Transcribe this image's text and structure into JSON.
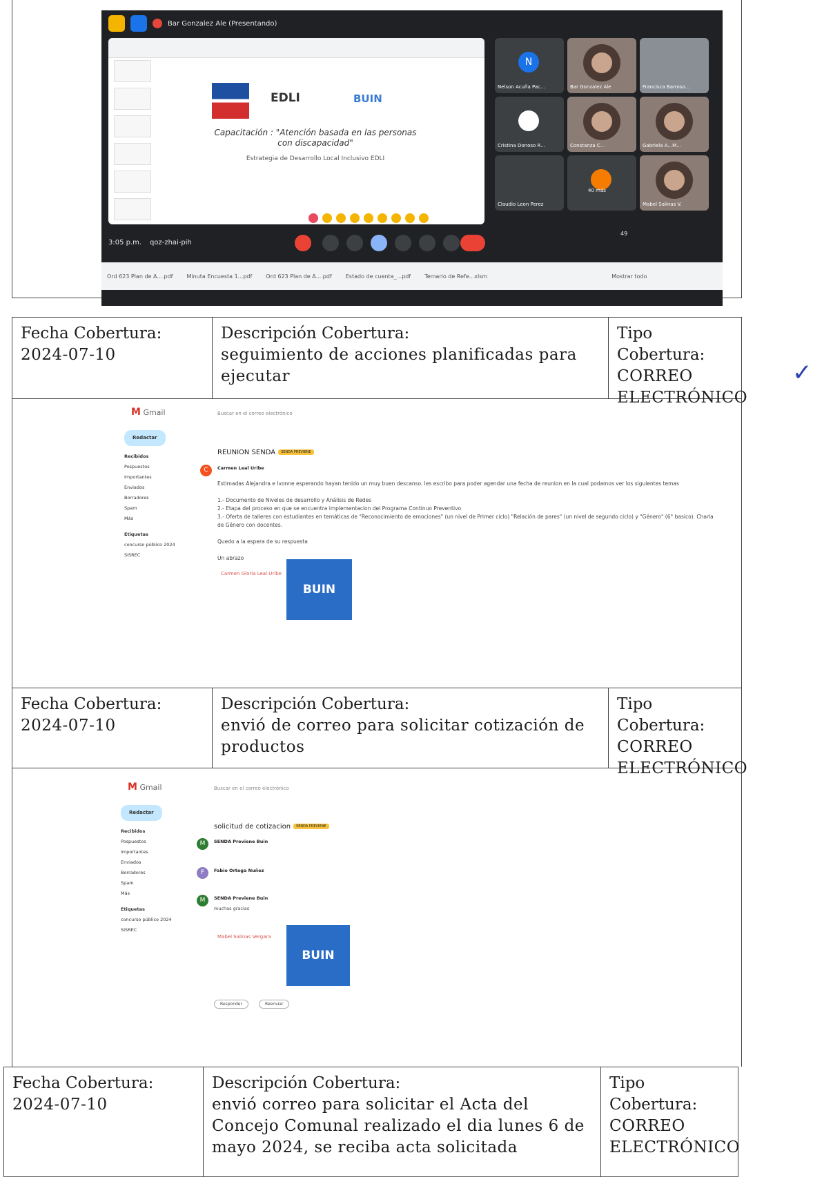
{
  "meet": {
    "presenter": "Bar Gonzalez Ale (Presentando)",
    "slide_logo_edli": "EDLI",
    "slide_logo_buin": "BUIN",
    "slide_title": "Capacitación : \"Atención basada en las personas con discapacidad\"",
    "slide_subtitle": "Estrategia de Desarrollo Local Inclusivo EDLI",
    "participants": [
      {
        "name": "Nelson Acuña Pac...",
        "initial": "N"
      },
      {
        "name": "Bar Gonzalez Ale",
        "initial": ""
      },
      {
        "name": "Francisca Barroso...",
        "initial": ""
      },
      {
        "name": "Cristina Donoso R...",
        "initial": ""
      },
      {
        "name": "Constanza C...",
        "initial": ""
      },
      {
        "name": "Gabriela A...M...",
        "initial": ""
      },
      {
        "name": "Claudio Leon Perez",
        "initial": ""
      },
      {
        "name": "40 más",
        "initial": ""
      },
      {
        "name": "Mabel Salinas V.",
        "initial": ""
      }
    ],
    "time": "3:05 p.m.",
    "meeting_code": "qoz-zhai-pih",
    "participant_count": "49",
    "downloads": [
      "Ord 623 Plan de A....pdf",
      "Minuta Encuesta 1...pdf",
      "Ord 623 Plan de A....pdf",
      "Estado de cuenta_...pdf",
      "Temario de Refe...xlsm"
    ],
    "show_all": "Mostrar todo"
  },
  "rows": [
    {
      "fecha_label": "Fecha Cobertura:",
      "fecha": "2024-07-10",
      "desc_label": "Descripción Cobertura:",
      "desc": "seguimiento de acciones planificadas para ejecutar",
      "tipo_label": "Tipo Cobertura:",
      "tipo": "CORREO ELECTRÓNICO"
    },
    {
      "fecha_label": "Fecha Cobertura:",
      "fecha": "2024-07-10",
      "desc_label": "Descripción Cobertura:",
      "desc": "envió de correo para solicitar cotización de productos",
      "tipo_label": "Tipo Cobertura:",
      "tipo": "CORREO ELECTRÓNICO"
    },
    {
      "fecha_label": "Fecha Cobertura:",
      "fecha": "2024-07-10",
      "desc_label": "Descripción Cobertura:",
      "desc": "envió correo para solicitar el Acta del Concejo Comunal realizado el dia lunes 6 de mayo 2024, se reciba acta solicitada",
      "tipo_label": "Tipo Cobertura:",
      "tipo": "CORREO ELECTRÓNICO"
    }
  ],
  "checkmark": "✓",
  "gmail1": {
    "app": "Gmail",
    "search_placeholder": "Buscar en el correo electrónico",
    "compose": "Redactar",
    "folders": [
      "Recibidos",
      "Pospuestos",
      "Importantes",
      "Enviados",
      "Borradores",
      "Spam",
      "Más"
    ],
    "labels_title": "Etiquetas",
    "labels": [
      "concurso público 2024",
      "SISREC"
    ],
    "subject": "REUNION SENDA",
    "tag": "SENDA PREVIENE",
    "sender": "Carmen Leal Uribe",
    "sender_initial": "C",
    "body": [
      "Estimadas Alejandra e Ivonne esperando hayan tenido un muy buen descanso. les escribo para poder agendar una fecha de reunion en la cual podamos ver los siguientes temas",
      "1.- Documento de Niveles de desarrollo y Análisis de Redes",
      "2.- Etapa del proceso en que se encuentra implementacion del Programa Continuo Preventivo",
      "3.- Oferta de talleres con estudiantes en temáticas de \"Reconocimiento de emociones\" (un nivel de Primer ciclo) \"Relación de pares\" (un nivel de segundo ciclo) y \"Género\" (6° basico). Charla de Género con docentes.",
      "Quedo a la espera de su respuesta",
      "Un abrazo"
    ],
    "sig_name": "Carmen Gloria Leal Uribe",
    "sig_logo": "BUIN"
  },
  "gmail2": {
    "app": "Gmail",
    "search_placeholder": "Buscar en el correo electrónico",
    "compose": "Redactar",
    "folders": [
      "Recibidos",
      "Pospuestos",
      "Importantes",
      "Enviados",
      "Borradores",
      "Spam",
      "Más"
    ],
    "labels_title": "Etiquetas",
    "labels": [
      "concurso público 2024",
      "SISREC"
    ],
    "subject": "solicitud de cotizacion",
    "tag": "SENDA PREVIENE",
    "messages": [
      {
        "sender": "SENDA Previene Buin",
        "initial": "M",
        "color": "#2e7d32"
      },
      {
        "sender": "Fabio Ortega Nuñez",
        "initial": "F",
        "color": "#8e7cc3"
      },
      {
        "sender": "SENDA Previene Buin",
        "initial": "M",
        "color": "#2e7d32"
      }
    ],
    "body_short": "muchas gracias",
    "sig_name": "Mabel Salinas Vergara",
    "sig_logo": "BUIN",
    "reply": "Responder",
    "forward": "Reenviar"
  }
}
